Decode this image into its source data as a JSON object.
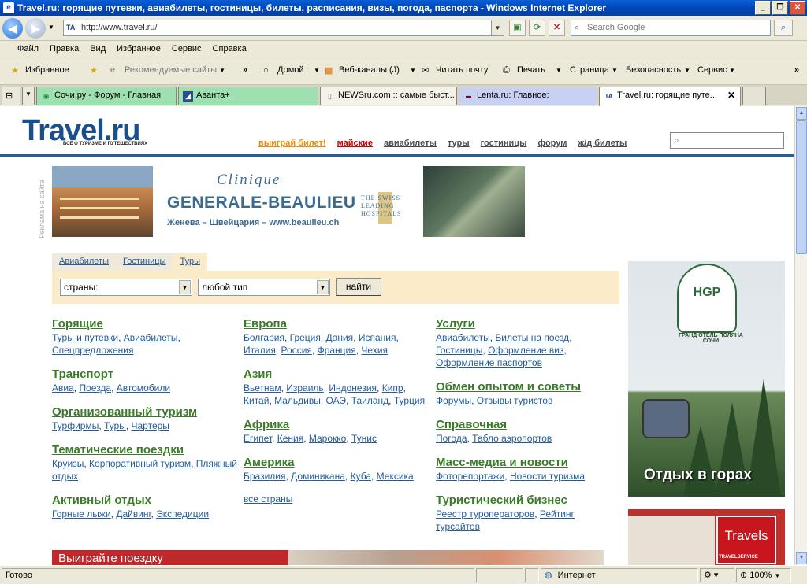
{
  "window": {
    "title": "Travel.ru: горящие путевки, авиабилеты, гостиницы, билеты, расписания, визы, погода, паспорта - Windows Internet Explorer",
    "minimize": "_",
    "maximize": "❐",
    "close": "✕"
  },
  "address": {
    "url": "http://www.travel.ru/",
    "favicon": "TA"
  },
  "search": {
    "placeholder": "Search Google"
  },
  "menu": [
    "Файл",
    "Правка",
    "Вид",
    "Избранное",
    "Сервис",
    "Справка"
  ],
  "favbar": {
    "favorites": "Избранное",
    "recommended": "Рекомендуемые сайты",
    "home": "Домой",
    "feeds": "Веб-каналы (J)",
    "mail": "Читать почту",
    "print": "Печать",
    "page": "Страница",
    "safety": "Безопасность",
    "tools": "Сервис"
  },
  "tabs": [
    {
      "label": "Сочи.ру - Форум - Главная"
    },
    {
      "label": "Аванта+"
    },
    {
      "label": "NEWSru.com :: самые быст..."
    },
    {
      "label": "Lenta.ru: Главное:"
    },
    {
      "label": "Travel.ru: горящие путе..."
    }
  ],
  "site": {
    "logo": "Travel.ru",
    "tagline": "ВСЁ О ТУРИЗМЕ И ПУТЕШЕСТВИЯХ",
    "nav": {
      "win": "выиграй билет!",
      "may": "майские",
      "avia": "авиабилеты",
      "tours": "туры",
      "hotels": "гостиницы",
      "forum": "форум",
      "rail": "ж/д билеты"
    }
  },
  "ad": {
    "label": "Реклама на сайте",
    "clinique_line1": "Clinique",
    "clinique_line2": "GENERALE-BEAULIEU",
    "clinique_line3": "Женева – Швейцария – www.beaulieu.ch",
    "swiss": "THE SWISS LEADING HOSPITALS"
  },
  "searchbox": {
    "tabs": [
      "Авиабилеты",
      "Гостиницы",
      "Туры"
    ],
    "country": "страны:",
    "type": "любой тип",
    "button": "найти"
  },
  "categories": {
    "col1": [
      {
        "title": "Горящие",
        "links": [
          "Туры и путевки",
          "Авиабилеты",
          "Спецпредложения"
        ]
      },
      {
        "title": "Транспорт",
        "links": [
          "Авиа",
          "Поезда",
          "Автомобили"
        ]
      },
      {
        "title": "Организованный туризм",
        "links": [
          "Турфирмы",
          "Туры",
          "Чартеры"
        ]
      },
      {
        "title": "Тематические поездки",
        "links": [
          "Круизы",
          "Корпоративный туризм",
          "Пляжный отдых"
        ]
      },
      {
        "title": "Активный отдых",
        "links": [
          "Горные лыжи",
          "Дайвинг",
          "Экспедиции"
        ]
      }
    ],
    "col2": [
      {
        "title": "Европа",
        "links": [
          "Болгария",
          "Греция",
          "Дания",
          "Испания",
          "Италия",
          "Россия",
          "Франция",
          "Чехия"
        ]
      },
      {
        "title": "Азия",
        "links": [
          "Вьетнам",
          "Израиль",
          "Индонезия",
          "Кипр",
          "Китай",
          "Мальдивы",
          "ОАЭ",
          "Таиланд",
          "Турция"
        ]
      },
      {
        "title": "Африка",
        "links": [
          "Египет",
          "Кения",
          "Марокко",
          "Тунис"
        ]
      },
      {
        "title": "Америка",
        "links": [
          "Бразилия",
          "Доминикана",
          "Куба",
          "Мексика"
        ]
      }
    ],
    "col2_all": "все страны",
    "col3": [
      {
        "title": "Услуги",
        "links": [
          "Авиабилеты",
          "Билеты на поезд",
          "Гостиницы",
          "Оформление виз",
          "Оформление паспортов"
        ]
      },
      {
        "title": "Обмен опытом и советы",
        "links": [
          "Форумы",
          "Отзывы туристов"
        ]
      },
      {
        "title": "Справочная",
        "links": [
          "Погода",
          "Табло аэропортов"
        ]
      },
      {
        "title": "Масс-медиа и новости",
        "links": [
          "Фоторепортажи",
          "Новости туризма"
        ]
      },
      {
        "title": "Туристический бизнес",
        "links": [
          "Реестр туроператоров",
          "Рейтинг турсайтов"
        ]
      }
    ]
  },
  "right_ad": {
    "logo": "HGP",
    "name": "ГРАНД ОТЕЛЬ ПОЛЯНА",
    "sub": "СОЧИ",
    "caption": "Отдых в горах"
  },
  "travels_ad": {
    "brand": "Travels",
    "sub": "TRAVELSERVICE"
  },
  "bottom_banner": "Выиграйте поездку",
  "status": {
    "text": "Готово",
    "zone": "Интернет",
    "zoom": "100%"
  }
}
